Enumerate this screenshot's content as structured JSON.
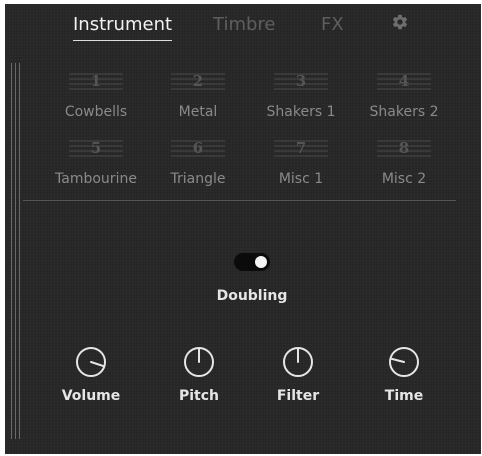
{
  "tabs": {
    "instrument": "Instrument",
    "timbre": "Timbre",
    "fx": "FX",
    "settings_icon": "gear-icon",
    "active": "instrument"
  },
  "slots": [
    {
      "number": "1",
      "name": "Cowbells",
      "active": true
    },
    {
      "number": "2",
      "name": "Metal",
      "active": false
    },
    {
      "number": "3",
      "name": "Shakers 1",
      "active": false
    },
    {
      "number": "4",
      "name": "Shakers 2",
      "active": false
    },
    {
      "number": "5",
      "name": "Tambourine",
      "active": false
    },
    {
      "number": "6",
      "name": "Triangle",
      "active": false
    },
    {
      "number": "7",
      "name": "Misc 1",
      "active": false
    },
    {
      "number": "8",
      "name": "Misc 2",
      "active": false
    }
  ],
  "doubling": {
    "label": "Doubling",
    "on": true
  },
  "knobs": [
    {
      "label": "Volume",
      "value": 0.9
    },
    {
      "label": "Pitch",
      "value": 0.5
    },
    {
      "label": "Filter",
      "value": 0.5
    },
    {
      "label": "Time",
      "value": 0.22
    }
  ],
  "colors": {
    "background": "#262626",
    "text_active": "#f2f2f2",
    "text_inactive": "#8a8a8a",
    "tab_inactive": "#5f5f5f",
    "toggle_track": "#0b0b0b"
  }
}
